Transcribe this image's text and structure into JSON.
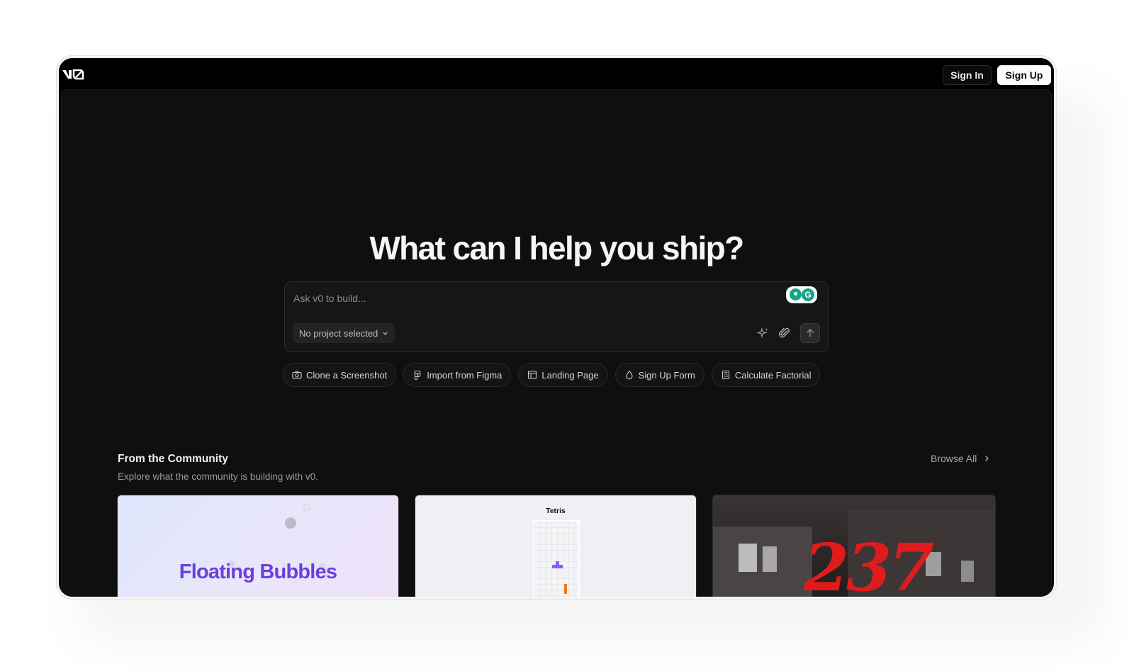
{
  "header": {
    "logo_name": "v0",
    "sign_in_label": "Sign In",
    "sign_up_label": "Sign Up"
  },
  "hero": {
    "headline": "What can I help you ship?"
  },
  "prompt": {
    "placeholder": "Ask v0 to build...",
    "project_select_label": "No project selected",
    "extension_badge_letter": "G"
  },
  "suggestions": [
    {
      "label": "Clone a Screenshot",
      "icon": "camera-icon"
    },
    {
      "label": "Import from Figma",
      "icon": "figma-icon"
    },
    {
      "label": "Landing Page",
      "icon": "layout-icon"
    },
    {
      "label": "Sign Up Form",
      "icon": "droplet-icon"
    },
    {
      "label": "Calculate Factorial",
      "icon": "calculator-icon"
    }
  ],
  "community": {
    "title": "From the Community",
    "subtitle": "Explore what the community is building with v0.",
    "browse_all_label": "Browse All",
    "cards": [
      {
        "title_text": "Floating Bubbles"
      },
      {
        "title_text": "Tetris"
      },
      {
        "title_text": "237"
      }
    ]
  },
  "colors": {
    "background": "#0f0f0f",
    "accent_purple": "#6b3fe0",
    "accent_red": "#e01b1b",
    "extension_green": "#11a88a"
  }
}
